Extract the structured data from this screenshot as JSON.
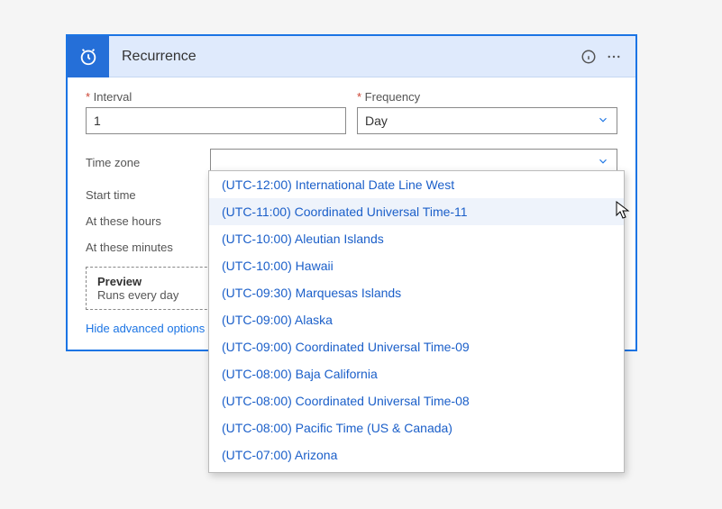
{
  "header": {
    "title": "Recurrence"
  },
  "fields": {
    "interval_label": "Interval",
    "interval_value": "1",
    "frequency_label": "Frequency",
    "frequency_value": "Day",
    "timezone_label": "Time zone",
    "timezone_value": "",
    "starttime_label": "Start time",
    "hours_label": "At these hours",
    "minutes_label": "At these minutes"
  },
  "preview": {
    "title": "Preview",
    "text": "Runs every day"
  },
  "links": {
    "hide_advanced": "Hide advanced options"
  },
  "timezone_options": [
    "(UTC-12:00) International Date Line West",
    "(UTC-11:00) Coordinated Universal Time-11",
    "(UTC-10:00) Aleutian Islands",
    "(UTC-10:00) Hawaii",
    "(UTC-09:30) Marquesas Islands",
    "(UTC-09:00) Alaska",
    "(UTC-09:00) Coordinated Universal Time-09",
    "(UTC-08:00) Baja California",
    "(UTC-08:00) Coordinated Universal Time-08",
    "(UTC-08:00) Pacific Time (US & Canada)",
    "(UTC-07:00) Arizona"
  ],
  "hover_index": 1
}
